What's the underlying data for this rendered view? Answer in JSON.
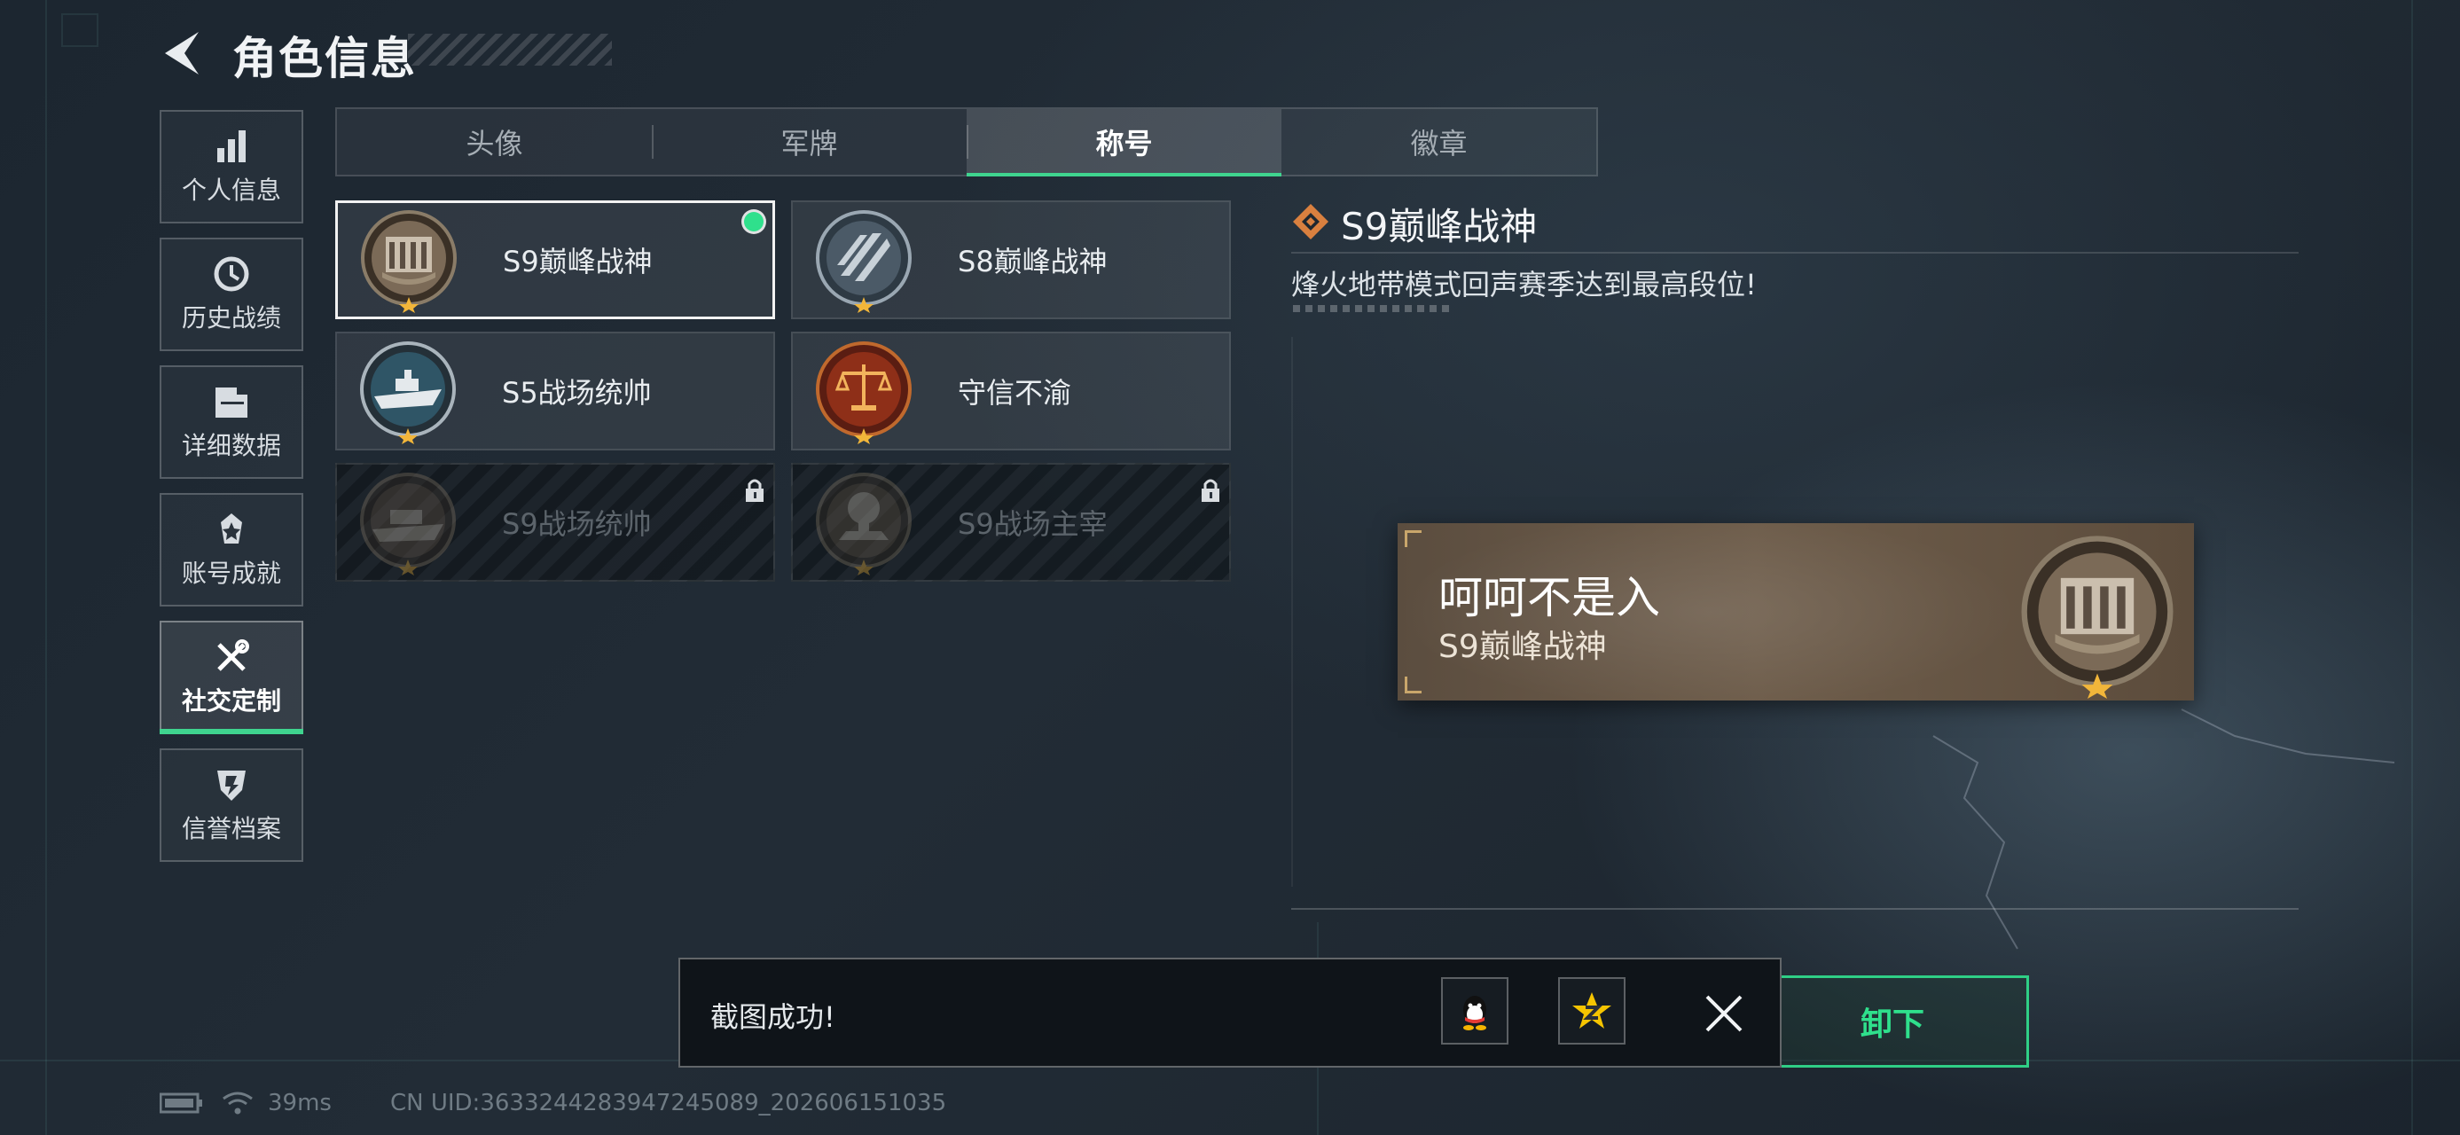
{
  "header": {
    "title": "角色信息"
  },
  "sidebar": {
    "items": [
      {
        "label": "个人信息",
        "icon": "bar-chart-icon"
      },
      {
        "label": "历史战绩",
        "icon": "clock-icon"
      },
      {
        "label": "详细数据",
        "icon": "folder-icon"
      },
      {
        "label": "账号成就",
        "icon": "achievement-icon"
      },
      {
        "label": "社交定制",
        "icon": "tools-icon",
        "active": true
      },
      {
        "label": "信誉档案",
        "icon": "shield-icon"
      }
    ]
  },
  "tabs": [
    {
      "label": "头像"
    },
    {
      "label": "军牌"
    },
    {
      "label": "称号",
      "active": true
    },
    {
      "label": "徽章"
    }
  ],
  "titles": [
    {
      "name": "S9巅峰战神",
      "selected": true,
      "equipped": true,
      "locked": false,
      "medal": "fortress-medal-icon"
    },
    {
      "name": "S8巅峰战神",
      "selected": false,
      "equipped": false,
      "locked": false,
      "medal": "stripes-medal-icon"
    },
    {
      "name": "S5战场统帅",
      "selected": false,
      "equipped": false,
      "locked": false,
      "medal": "warship-medal-icon"
    },
    {
      "name": "守信不渝",
      "selected": false,
      "equipped": false,
      "locked": false,
      "medal": "scales-medal-icon"
    },
    {
      "name": "S9战场统帅",
      "selected": false,
      "equipped": false,
      "locked": true,
      "medal": "battleship-medal-icon"
    },
    {
      "name": "S9战场主宰",
      "selected": false,
      "equipped": false,
      "locked": true,
      "medal": "explosion-medal-icon"
    }
  ],
  "detail": {
    "title": "S9巅峰战神",
    "description": "烽火地带模式回声赛季达到最高段位!"
  },
  "preview": {
    "player_name": "呵呵不是入",
    "title": "S9巅峰战神"
  },
  "action_button": {
    "label": "卸下"
  },
  "toast": {
    "message": "截图成功!",
    "share_targets": [
      "qq-icon",
      "qzone-icon"
    ]
  },
  "footer": {
    "ping": "39ms",
    "uid": "CN UID:3633244283947245089_202606151035"
  },
  "colors": {
    "accent": "#3fd48f",
    "background": "#1f2932",
    "card": "#2c353e"
  }
}
